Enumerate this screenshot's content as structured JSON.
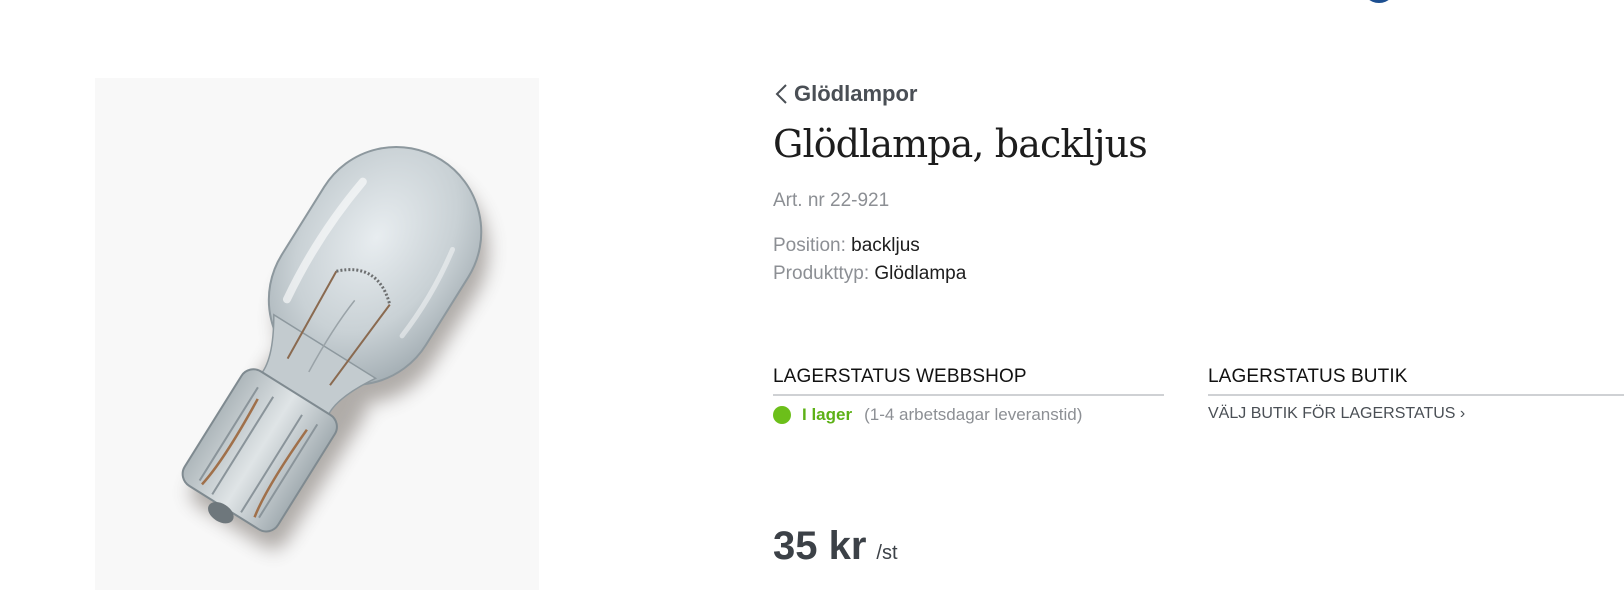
{
  "brand": {
    "logo_icon": "brand-logo-icon",
    "colors": {
      "blue": "#1d4f91",
      "yellow": "#f5c400"
    }
  },
  "product": {
    "image_icon": "light-bulb-image",
    "breadcrumb": "Glödlampor",
    "title": "Glödlampa, backljus",
    "article_number": "Art. nr 22-921",
    "properties": [
      {
        "label": "Position:",
        "value": "backljus"
      },
      {
        "label": "Produkttyp:",
        "value": "Glödlampa"
      }
    ],
    "price": {
      "amount": "35 kr",
      "unit": "/st"
    }
  },
  "stock": {
    "webshop": {
      "heading": "LAGERSTATUS WEBBSHOP",
      "status": "I lager",
      "status_color": "#6cbf1a",
      "delivery": "(1-4 arbetsdagar leveranstid)"
    },
    "store": {
      "heading": "LAGERSTATUS BUTIK",
      "link": "VÄLJ BUTIK FÖR LAGERSTATUS ›"
    }
  }
}
